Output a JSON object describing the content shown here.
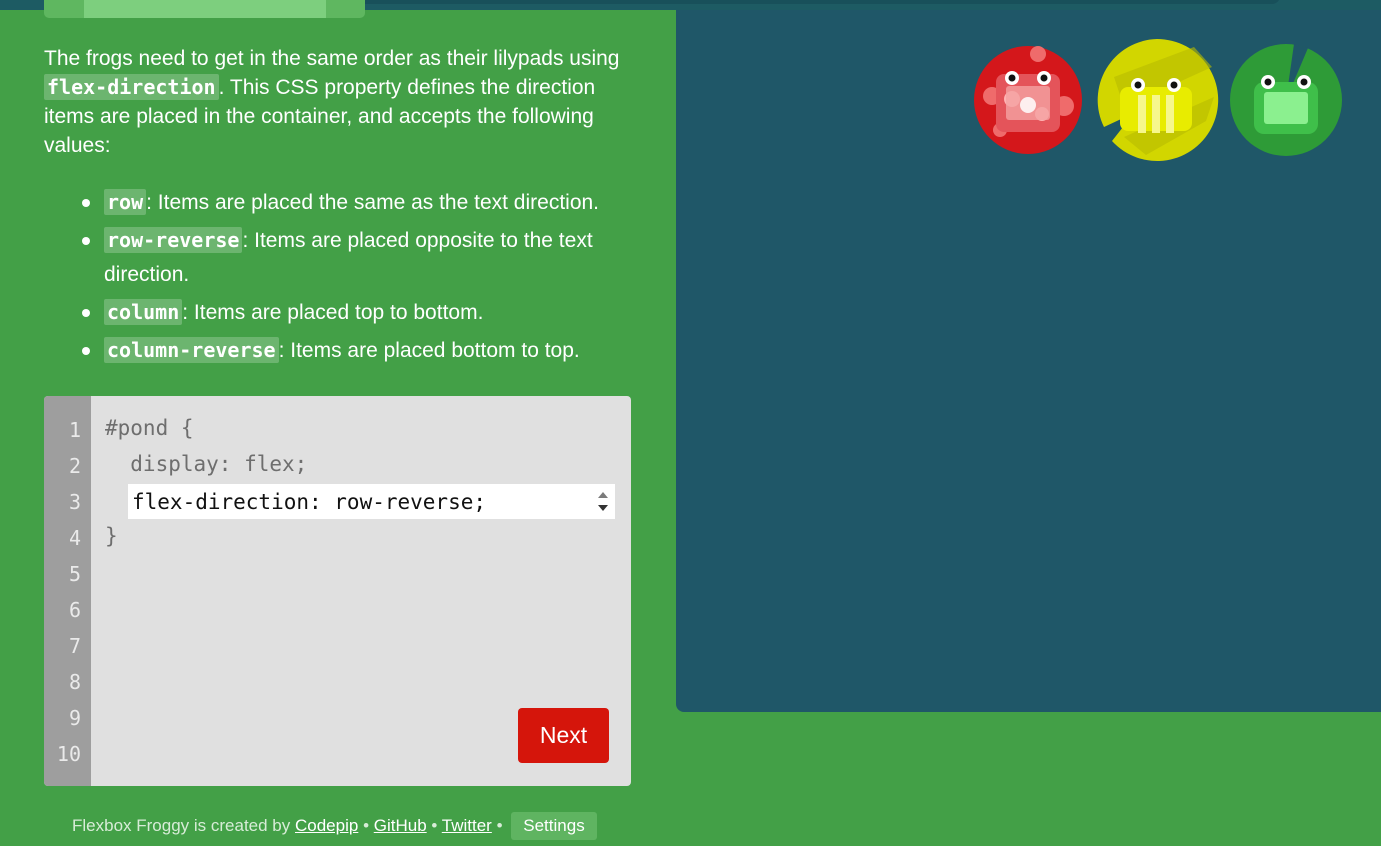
{
  "instructions": {
    "intro_1": "The frogs need to get in the same order as their lilypads using",
    "intro_code": "flex-direction",
    "intro_2": ". This CSS property defines the direction items are placed in the container, and accepts the following values:",
    "values": [
      {
        "code": "row",
        "text": ": Items are placed the same as the text direction."
      },
      {
        "code": "row-reverse",
        "text": ": Items are placed opposite to the text direction."
      },
      {
        "code": "column",
        "text": ": Items are placed top to bottom."
      },
      {
        "code": "column-reverse",
        "text": ": Items are placed bottom to top."
      }
    ]
  },
  "editor": {
    "line_numbers": [
      "1",
      "2",
      "3",
      "4",
      "5",
      "6",
      "7",
      "8",
      "9",
      "10"
    ],
    "line1": "#pond {",
    "line2": "  display: flex;",
    "input_value": "flex-direction: row-reverse;",
    "line4": "}",
    "next_label": "Next"
  },
  "footer": {
    "credit": "Flexbox Froggy is created by",
    "codepip": "Codepip",
    "sep1": "•",
    "github": "GitHub",
    "sep2": "•",
    "twitter": "Twitter",
    "sep3": "•",
    "settings": "Settings"
  },
  "pond": {
    "lilypads": [
      {
        "color": "red",
        "hex": "#d4171b"
      },
      {
        "color": "yellow",
        "hex": "#d2d600"
      },
      {
        "color": "green",
        "hex": "#2e9b37"
      }
    ]
  },
  "colors": {
    "background": "#43a047",
    "pond": "#1f5768",
    "next_button": "#d5150b"
  }
}
